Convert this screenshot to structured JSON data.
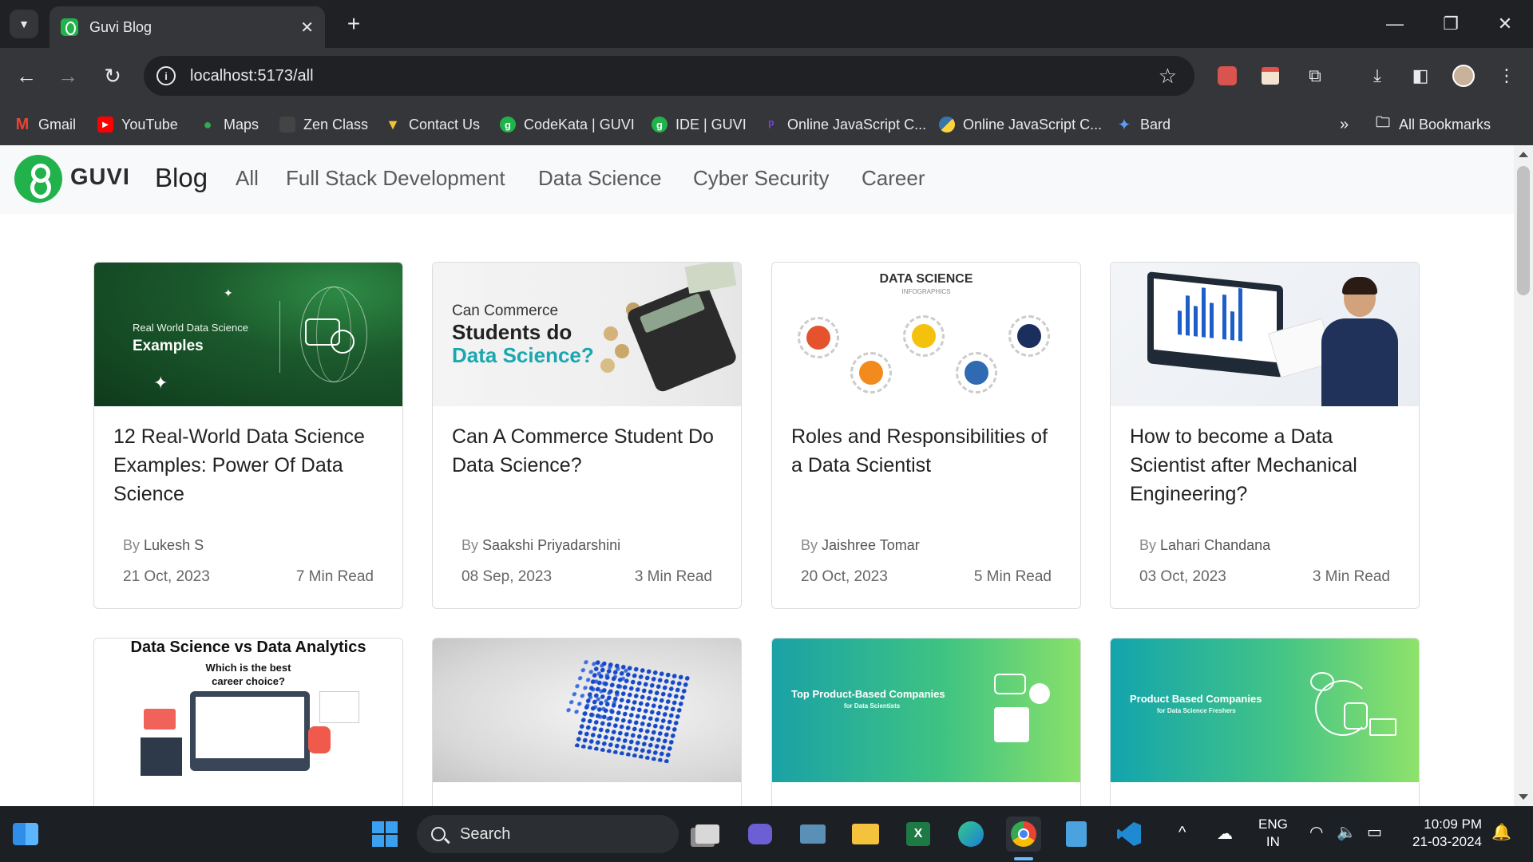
{
  "browser": {
    "tab_title": "Guvi Blog",
    "url": "localhost:5173/all",
    "bookmarks": [
      "Gmail",
      "YouTube",
      "Maps",
      "Zen Class",
      "Contact Us",
      "CodeKata | GUVI",
      "IDE | GUVI",
      "Online JavaScript C...",
      "Online JavaScript C...",
      "Bard"
    ],
    "all_bookmarks": "All Bookmarks"
  },
  "site": {
    "logo_text": "GUVI",
    "brand": "Blog",
    "nav": [
      "All",
      "Full Stack Development",
      "Data Science",
      "Cyber Security",
      "Career"
    ]
  },
  "posts": [
    {
      "title": "12 Real-World Data Science Examples: Power Of Data Science",
      "by": "By",
      "author": "Lukesh S",
      "date": "21 Oct, 2023",
      "read": "7 Min Read",
      "thumb": {
        "small": "Real World Data Science",
        "big": "Examples"
      }
    },
    {
      "title": "Can A Commerce Student Do Data Science?",
      "by": "By",
      "author": "Saakshi Priyadarshini",
      "date": "08 Sep, 2023",
      "read": "3 Min Read",
      "thumb": {
        "l1": "Can Commerce",
        "l2": "Students do",
        "l3": "Data Science?"
      }
    },
    {
      "title": "Roles and Responsibilities of a Data Scientist",
      "by": "By",
      "author": "Jaishree Tomar",
      "date": "20 Oct, 2023",
      "read": "5 Min Read",
      "thumb": {
        "h": "DATA SCIENCE",
        "s": "INFOGRAPHICS"
      }
    },
    {
      "title": "How to become a Data Scientist after Mechanical Engineering?",
      "by": "By",
      "author": "Lahari Chandana",
      "date": "03 Oct, 2023",
      "read": "3 Min Read",
      "thumb": {}
    }
  ],
  "posts_row2": [
    {
      "thumb": {
        "h": "Data Science vs Data Analytics",
        "s1": "Which is the best",
        "s2": "career choice?"
      }
    },
    {
      "thumb": {}
    },
    {
      "thumb": {
        "a": "Top Product-Based Companies",
        "b": "for Data Scientists"
      }
    },
    {
      "thumb": {
        "a": "Product Based Companies",
        "b": "for Data Science Freshers"
      }
    }
  ],
  "taskbar": {
    "search": "Search",
    "lang1": "ENG",
    "lang2": "IN",
    "time": "10:09 PM",
    "date": "21-03-2024"
  },
  "colors": {
    "brand_green": "#21b24b",
    "teal": "#1aa7b0",
    "chrome_dark": "#202124"
  }
}
